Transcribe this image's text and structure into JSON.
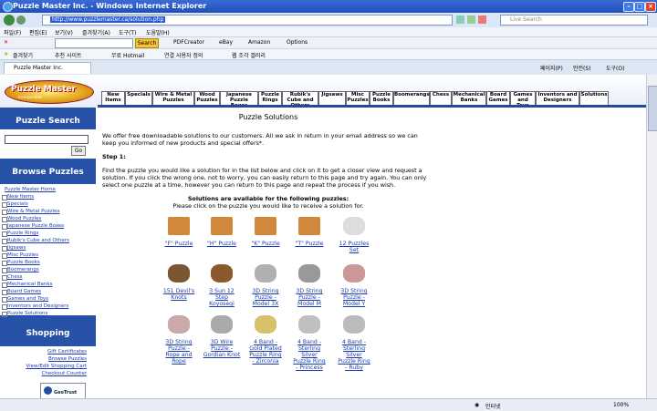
{
  "window": {
    "title": "Puzzle Master Inc. - Windows Internet Explorer"
  },
  "browser": {
    "address": "http://www.puzzlemaster.ca/solution.php",
    "search_placeholder": "Live Search",
    "menu": [
      "파일(F)",
      "편집(E)",
      "보기(V)",
      "즐겨찾기(A)",
      "도구(T)",
      "도움말(H)"
    ],
    "yahoo": {
      "search_btn": "Search",
      "items": [
        "PDFCreator",
        "eBay",
        "Amazon",
        "Options"
      ]
    },
    "favorites": {
      "label": "즐겨찾기",
      "items": [
        "추천 사이트",
        "무료 Hotmail",
        "연결 사용자 정의",
        "웹 조각 갤러리"
      ]
    },
    "tab_title": "Puzzle Master Inc.",
    "cmd": [
      "페이지(P)",
      "안전(S)",
      "도구(O)"
    ]
  },
  "site": {
    "logo_text": "Puzzle Master",
    "logo_sub": "incorporated",
    "nav": [
      "New Items",
      "Specials",
      "Wire & Metal Puzzles",
      "Wood Puzzles",
      "Japanese Puzzle Boxes",
      "Puzzle Rings",
      "Rubik's Cube and Others",
      "Jigsaws",
      "Misc Puzzles",
      "Puzzle Books",
      "Boomerangs",
      "Chess",
      "Mechanical Banks",
      "Board Games",
      "Games and Toys",
      "Inventors and Designers",
      "Solutions"
    ]
  },
  "sidebar": {
    "search_title": "Puzzle Search",
    "go_label": "Go",
    "browse_title": "Browse Puzzles",
    "root": "Puzzle Master Home",
    "categories": [
      "New Items",
      "Specials",
      "Wire & Metal Puzzles",
      "Wood Puzzles",
      "Japanese Puzzle Boxes",
      "Puzzle Rings",
      "Rubik's Cube and Others",
      "Jigsaws",
      "Misc Puzzles",
      "Puzzle Books",
      "Boomerangs",
      "Chess",
      "Mechanical Banks",
      "Board Games",
      "Games and Toys",
      "Inventors and Designers",
      "Puzzle Solutions"
    ],
    "shopping_title": "Shopping",
    "shopping": [
      "Gift Certificates",
      "Browse Puzzles",
      "View/Edit Shopping Cart",
      "Checkout Counter"
    ],
    "badge": "GeoTrust"
  },
  "main": {
    "title": "Puzzle Solutions",
    "intro": "We offer free downloadable solutions to our customers. All we ask in return in your email address so we can keep you informed of new products and special offers*.",
    "step": "Step 1:",
    "instructions": "Find the puzzle you would like a solution for in the list below and click on it to get a closer view and request a solution. If you click the wrong one, not to worry, you can easily return to this page and try again. You can only select one puzzle at a time, however you can return to this page and repeat the process if you wish.",
    "available": "Solutions are available for the following puzzles:",
    "click_note": "Please click on the puzzle you would like to receive a solution for.",
    "products": [
      [
        "\"F\" Puzzle"
      ],
      [
        "\"H\" Puzzle"
      ],
      [
        "\"K\" Puzzle"
      ],
      [
        "\"T\" Puzzle"
      ],
      [
        "12 Puzzles",
        "Set"
      ],
      [
        "151 Devil's",
        "Knots"
      ],
      [
        "3 Sun 12",
        "Step",
        "Koyosegi"
      ],
      [
        "3D String",
        "Puzzle -",
        "Model 3X"
      ],
      [
        "3D String",
        "Puzzle -",
        "Model M"
      ],
      [
        "3D String",
        "Puzzle -",
        "Model Y"
      ],
      [
        "3D String",
        "Puzzle -",
        "Rope and",
        "Rope"
      ],
      [
        "3D Wire",
        "Puzzle -",
        "Gordian Knot"
      ],
      [
        "4 Band -",
        "Gold Plated",
        "Puzzle Ring",
        "- Zirconia"
      ],
      [
        "4 Band -",
        "Sterling",
        "Silver",
        "Puzzle Ring",
        "- Princess"
      ],
      [
        "4 Band -",
        "Sterling",
        "Silver",
        "Puzzle Ring",
        "- Ruby"
      ]
    ]
  },
  "status": {
    "zone": "인터넷",
    "zoom": "100%"
  }
}
